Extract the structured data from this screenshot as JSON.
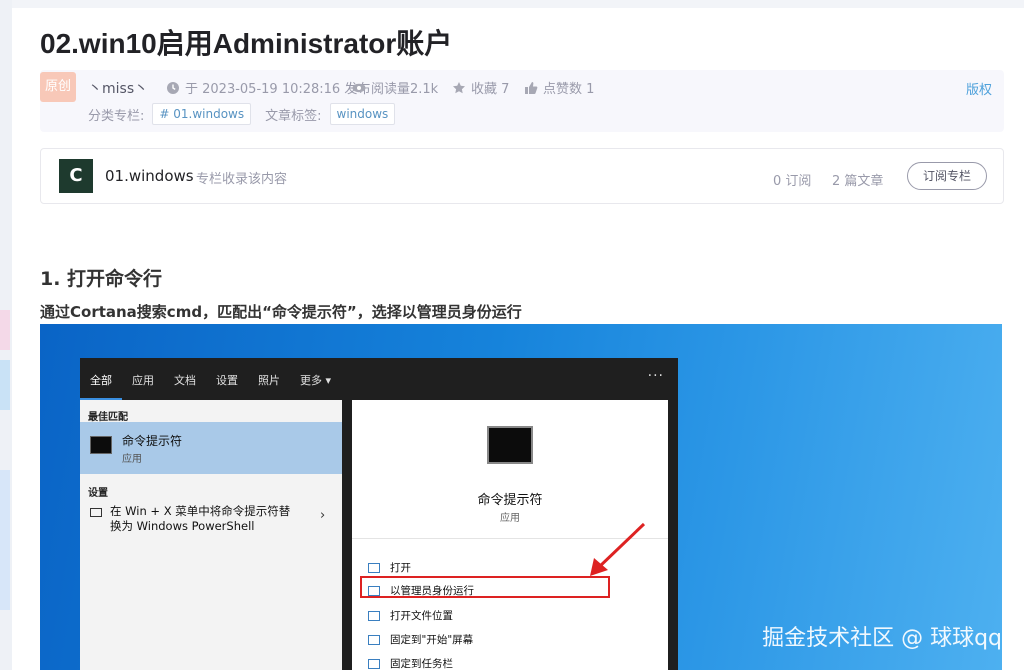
{
  "article": {
    "title": "02.win10启用Administrator账户",
    "badge": "原创",
    "author": "丶miss丶",
    "time": "于 2023-05-19 10:28:16 发布",
    "reads": "阅读量2.1k",
    "favorites": "收藏 7",
    "likes": "点赞数 1",
    "copyright": "版权",
    "category_label": "分类专栏:",
    "category_tag": "# 01.windows",
    "tags_label": "文章标签:",
    "tag": "windows"
  },
  "column": {
    "icon_letter": "C",
    "name": "01.windows",
    "desc": "专栏收录该内容",
    "subs": "0 订阅",
    "articles": "2 篇文章",
    "button": "订阅专栏"
  },
  "content": {
    "heading": "1. 打开命令行",
    "paragraph": "通过Cortana搜索cmd，匹配出“命令提示符”，选择以管理员身份运行"
  },
  "screenshot": {
    "tabs": [
      "全部",
      "应用",
      "文档",
      "设置",
      "照片",
      "更多 ▾"
    ],
    "more": "···",
    "best_match": "最佳匹配",
    "best_name": "命令提示符",
    "best_type": "应用",
    "settings": "设置",
    "setting_item": "在 Win + X 菜单中将命令提示符替换为 Windows PowerShell",
    "arrow": "›",
    "rp_name": "命令提示符",
    "rp_type": "应用",
    "actions": [
      "打开",
      "以管理员身份运行",
      "打开文件位置",
      "固定到\"开始\"屏幕",
      "固定到任务栏"
    ],
    "watermark": "掘金技术社区 @ 球球qq"
  },
  "colors": {
    "accent": "#4ea1db",
    "highlight_box": "#d22222",
    "desktop_blue": "#1683db"
  }
}
